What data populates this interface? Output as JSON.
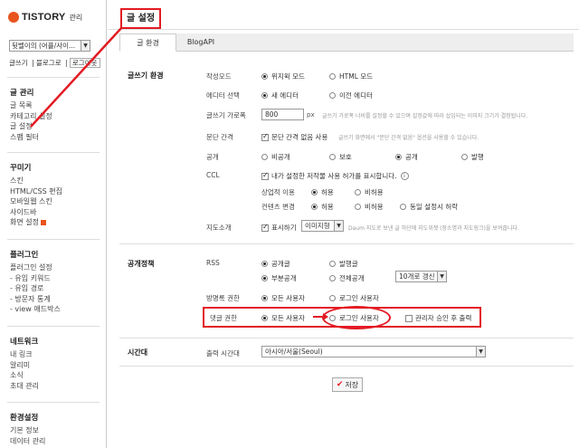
{
  "sidebar": {
    "logo": "TISTORY",
    "logo_sub": "관리",
    "blog_select": "뒷벨이의 (어플/사이...",
    "quick_links": [
      "글쓰기",
      "블로그로",
      "로그아웃"
    ],
    "groups": [
      {
        "title": "글 관리",
        "items": [
          "글 목록",
          "카테고리 설정",
          "글 설정",
          "스팸 필터"
        ]
      },
      {
        "title": "꾸미기",
        "items": [
          "스킨",
          "HTML/CSS 편집",
          "모바일웹 스킨",
          "사이드바",
          "화면 설정"
        ]
      },
      {
        "title": "플러그인",
        "items": [
          "플러그인 설정",
          "- 유입 키워드",
          "- 유입 경로",
          "- 방문자 통계",
          "- view 애드박스"
        ]
      },
      {
        "title": "네트워크",
        "items": [
          "내 링크",
          "알리미",
          "소식",
          "초대 관리"
        ]
      },
      {
        "title": "환경설정",
        "items": [
          "기본 정보",
          "데이터 관리"
        ]
      }
    ]
  },
  "page_title": "글 설정",
  "tabs": [
    "글 환경",
    "BlogAPI"
  ],
  "sections": {
    "writing": {
      "label": "글쓰기 환경",
      "mode_label": "작성모드",
      "mode_opts": [
        "위지윅 모드",
        "HTML 모드"
      ],
      "editor_label": "에디터 선택",
      "editor_opts": [
        "새 에디터",
        "이전 에디터"
      ],
      "width_label": "글쓰기 가로폭",
      "width_value": "800",
      "width_unit": "px",
      "width_hint": "글쓰기 가로폭 너비를 설정할 수 있으며 설정값에 따라 삽입되는 이미지 크기가 결정됩니다.",
      "para_label": "문단 간격",
      "para_check": "문단 간격 없음 사용",
      "para_hint": "글쓰기 화면에서 \"문단 간격 없음\" 옵션을 사용할 수 있습니다.",
      "visibility_label": "공개",
      "visibility_opts": [
        "비공개",
        "보호",
        "공개",
        "발행"
      ],
      "ccl_label": "CCL",
      "ccl_check": "내가 설정한 저작물 사용 허가를 표시합니다.",
      "commercial_label": "상업적 이용",
      "commercial_opts": [
        "허용",
        "비허용"
      ],
      "modify_label": "컨텐츠 변경",
      "modify_opts": [
        "허용",
        "비허용",
        "동일 설정시 허락"
      ],
      "map_label": "지도소개",
      "map_check": "표시하기",
      "map_select": "이미지형",
      "map_hint": "Daum 지도로 보낸 글 하단에 지도위젯 (장소명과 지도링크)을 보여줍니다."
    },
    "policy": {
      "label": "공개정책",
      "rss_label": "RSS",
      "rss_opts_1": [
        "공개글",
        "발행글"
      ],
      "rss_opts_2": [
        "부분공개",
        "전체공개"
      ],
      "rss_count_select": "10개로 갱신",
      "guestbook_label": "방명록 권한",
      "guestbook_opts": [
        "모든 사용자",
        "로그인 사용자"
      ],
      "comment_label": "댓글 권한",
      "comment_opts": [
        "모든 사용자",
        "로그인 사용자"
      ],
      "comment_check": "관리자 승인 후 출력"
    },
    "timezone": {
      "label": "시간대",
      "row_label": "출력 시간대",
      "select": "아시아/서울(Seoul)"
    }
  },
  "save_label": "저장"
}
